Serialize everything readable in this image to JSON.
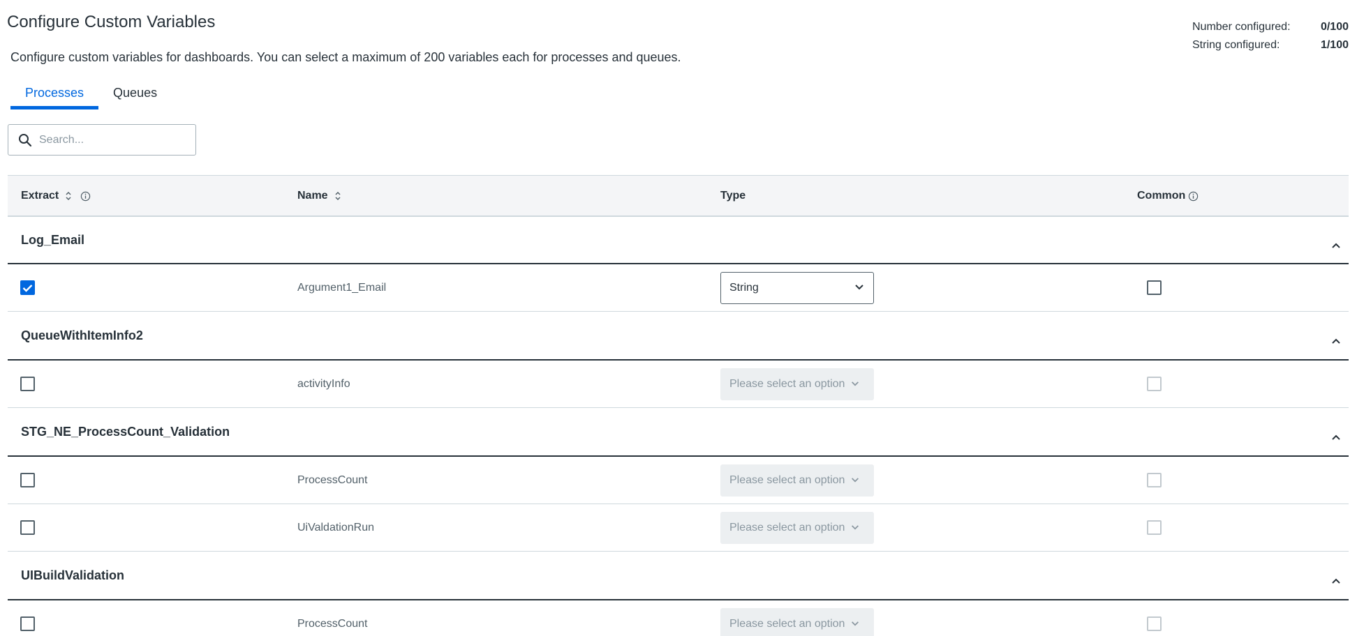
{
  "page": {
    "title": "Configure Custom Variables",
    "description": "Configure custom variables for dashboards. You can select a maximum of 200 variables each for processes and queues."
  },
  "stats": {
    "number_label": "Number configured:",
    "number_value": "0/100",
    "string_label": "String configured:",
    "string_value": "1/100"
  },
  "tabs": [
    {
      "label": "Processes",
      "active": true
    },
    {
      "label": "Queues",
      "active": false
    }
  ],
  "search": {
    "placeholder": "Search...",
    "value": ""
  },
  "table": {
    "headers": {
      "extract": "Extract",
      "name": "Name",
      "type": "Type",
      "common": "Common"
    },
    "groups": [
      {
        "name": "Log_Email",
        "rows": [
          {
            "name": "Argument1_Email",
            "extract": true,
            "type": "String",
            "common": false
          }
        ]
      },
      {
        "name": "QueueWithItemInfo2",
        "rows": [
          {
            "name": "activityInfo",
            "extract": false,
            "type": "Please select an option",
            "common": false
          }
        ]
      },
      {
        "name": "STG_NE_ProcessCount_Validation",
        "rows": [
          {
            "name": "ProcessCount",
            "extract": false,
            "type": "Please select an option",
            "common": false
          },
          {
            "name": "UiValdationRun",
            "extract": false,
            "type": "Please select an option",
            "common": false
          }
        ]
      },
      {
        "name": "UIBuildValidation",
        "rows": [
          {
            "name": "ProcessCount",
            "extract": false,
            "type": "Please select an option",
            "common": false
          }
        ]
      }
    ]
  },
  "colors": {
    "accent": "#0067df",
    "text": "#273139",
    "muted": "#526069"
  }
}
